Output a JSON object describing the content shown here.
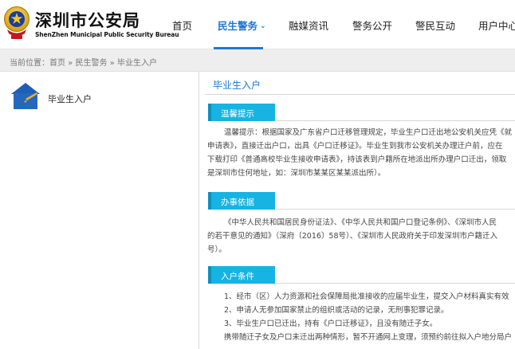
{
  "header": {
    "brand_cn": "深圳市公安局",
    "brand_en": "ShenZhen Municipal Public Security Bureau",
    "emblem_icon": "police-emblem-icon",
    "nav": [
      {
        "label": "首页",
        "active": false
      },
      {
        "label": "民生警务",
        "active": true
      },
      {
        "label": "融媒资讯",
        "active": false
      },
      {
        "label": "警务公开",
        "active": false
      },
      {
        "label": "警民互动",
        "active": false
      },
      {
        "label": "用户中心",
        "active": false
      }
    ],
    "active_color": "#1e78d2"
  },
  "breadcrumb": {
    "prefix": "当前位置：",
    "items": [
      "首页",
      "民生警务",
      "毕业生入户"
    ],
    "separator": " » "
  },
  "sidebar": {
    "items": [
      {
        "label": "毕业生入户",
        "icon": "house-icon"
      }
    ]
  },
  "main": {
    "title": "毕业生入户",
    "sections": [
      {
        "heading": "温馨提示",
        "lines": [
          "温馨提示：根据国家及广东省户口迁移管理规定，毕业生户口迁出地公安机关应凭《就",
          "申请表》，直接迁出户口，出具《户口迁移证》。毕业生到我市公安机关办理迁户前，应在",
          "下载打印《普通高校毕业生接收申请表》，持该表到户籍所在地派出所办理户口迁出，领取",
          "是深圳市住何地址，如：深圳市某某区某某派出所）。"
        ]
      },
      {
        "heading": "办事依据",
        "lines": [
          "《中华人民共和国居民身份证法》、《中华人民共和国户口登记条例》、《深圳市人民",
          "的若干意见的通知》（深府〔2016〕58号）、《深圳市人民政府关于印发深圳市户籍迁入",
          "号）。"
        ]
      },
      {
        "heading": "入户条件",
        "lines": [
          "1、经市（区）人力资源和社会保障局批准接收的应届毕业生，提交入户材料真实有效",
          "2、申请人无参加国家禁止的组织或活动的记录，无刑事犯罪记录。",
          "3、毕业生户口已迁出，持有《户口迁移证》，且没有随迁子女。",
          "携带随迁子女及户口未迁出两种情形，暂不开通网上变理，须预约前往拟入户地分局户"
        ]
      }
    ],
    "tab_color": "#16b3e3"
  }
}
